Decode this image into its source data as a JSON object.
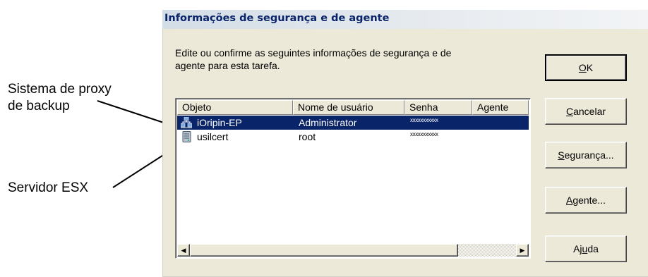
{
  "callouts": {
    "proxy_line1": "Sistema de proxy",
    "proxy_line2": "de backup",
    "esx": "Servidor ESX"
  },
  "dialog": {
    "title": "Informações de segurança e de agente",
    "description_line1": "Edite ou confirme as seguintes informações de segurança e de",
    "description_line2": "agente para esta tarefa."
  },
  "list": {
    "columns": [
      "Objeto",
      "Nome de usuário",
      "Senha",
      "Agente"
    ],
    "rows": [
      {
        "icon": "server-network-icon",
        "object": "iOripin-EP",
        "username": "Administrator",
        "password": "xxxxxxxxxxx",
        "agent": "",
        "selected": true
      },
      {
        "icon": "esx-server-icon",
        "object": "usilcert",
        "username": "root",
        "password": "xxxxxxxxxxx",
        "agent": "",
        "selected": false
      }
    ],
    "scroll_left_icon": "arrow-left-icon",
    "scroll_right_icon": "arrow-right-icon"
  },
  "buttons": {
    "ok": {
      "mnemonic": "O",
      "rest": "K"
    },
    "cancel": {
      "mnemonic": "C",
      "rest": "ancelar"
    },
    "security": {
      "mnemonic": "S",
      "rest": "egurança..."
    },
    "agent": {
      "mnemonic": "A",
      "rest": "gente..."
    },
    "help": {
      "pre": "Aj",
      "mnemonic": "u",
      "rest": "da"
    }
  },
  "colors": {
    "selection": "#0a246a",
    "dialog_bg": "#ece9d8",
    "title_text": "#0a246a"
  }
}
